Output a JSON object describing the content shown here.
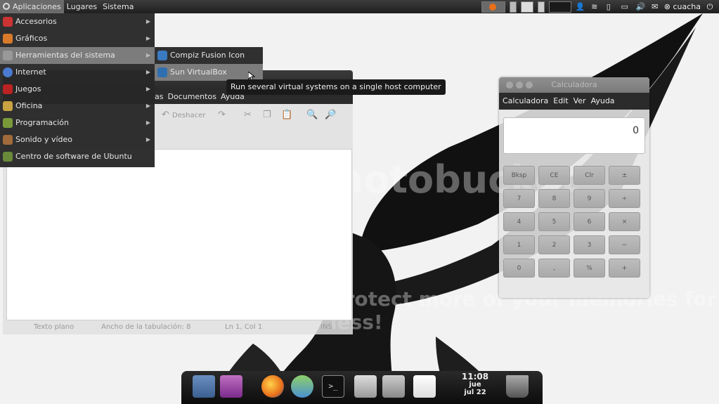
{
  "top_panel": {
    "menus": [
      "Aplicaciones",
      "Lugares",
      "Sistema"
    ],
    "user": "cuacha"
  },
  "app_menu": {
    "items": [
      {
        "label": "Accesorios",
        "icon": "accessories-icon"
      },
      {
        "label": "Gráficos",
        "icon": "graphics-icon"
      },
      {
        "label": "Herramientas del sistema",
        "icon": "system-tools-icon"
      },
      {
        "label": "Internet",
        "icon": "internet-globe-icon"
      },
      {
        "label": "Juegos",
        "icon": "games-cards-icon"
      },
      {
        "label": "Oficina",
        "icon": "office-icon"
      },
      {
        "label": "Programación",
        "icon": "programming-icon"
      },
      {
        "label": "Sonido y vídeo",
        "icon": "sound-video-icon"
      },
      {
        "label": "Centro de software de Ubuntu",
        "icon": "software-center-icon"
      }
    ],
    "submenu": [
      {
        "label": "Compiz Fusion Icon",
        "icon": "compiz-icon"
      },
      {
        "label": "Sun VirtualBox",
        "icon": "virtualbox-icon"
      }
    ],
    "tooltip": "Run several virtual systems on a single host computer"
  },
  "gedit": {
    "menus": [
      "as",
      "Documentos",
      "Ayuda"
    ],
    "undo_label": "Deshacer",
    "status": {
      "language": "Texto plano",
      "tab_width": "Ancho de la tabulación: 8",
      "position": "Ln 1, Col 1",
      "mode": "INS"
    }
  },
  "calculator": {
    "title": "Calculadora",
    "menus": [
      "Calculadora",
      "Edit",
      "Ver",
      "Ayuda"
    ],
    "display": "0",
    "keys": [
      [
        "Bksp",
        "CE",
        "Clr",
        "±"
      ],
      [
        "7",
        "8",
        "9",
        "÷"
      ],
      [
        "4",
        "5",
        "6",
        "×"
      ],
      [
        "1",
        "2",
        "3",
        "−"
      ],
      [
        "0",
        ",",
        "%",
        "+"
      ]
    ]
  },
  "dock": {
    "clock_time": "11:08",
    "clock_day": "jue",
    "clock_date": "jul 22"
  },
  "watermark": {
    "line1": "photobucket",
    "line2": "Protect more of your memories for less!"
  },
  "colors": {
    "panel": "#2a2a2a",
    "menu_bg": "#282828",
    "menu_active": "#7c7c7c",
    "firefox_orange": "#e8701a"
  }
}
